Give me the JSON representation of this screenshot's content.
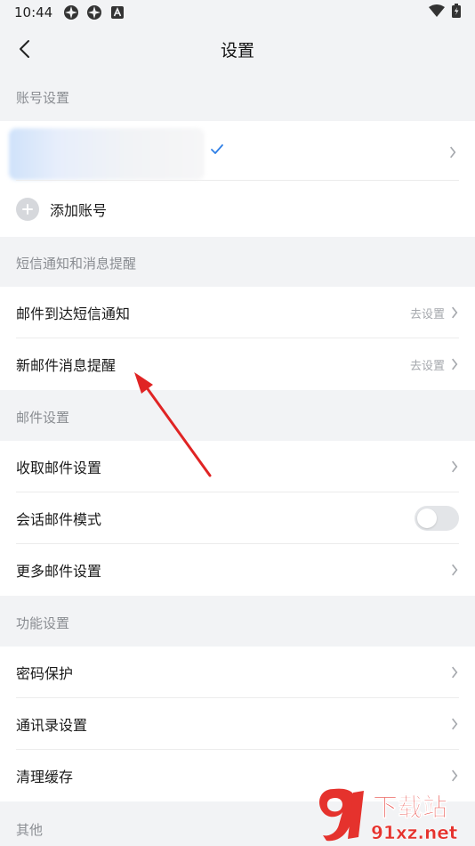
{
  "status_bar": {
    "time": "10:44"
  },
  "nav": {
    "title": "设置"
  },
  "sections": {
    "account": "账号设置",
    "sms": "短信通知和消息提醒",
    "mail": "邮件设置",
    "features": "功能设置",
    "other": "其他"
  },
  "account": {
    "add_label": "添加账号"
  },
  "sms_rows": {
    "arrival": {
      "label": "邮件到达短信通知",
      "action": "去设置"
    },
    "new_mail": {
      "label": "新邮件消息提醒",
      "action": "去设置"
    }
  },
  "mail_rows": {
    "receive": "收取邮件设置",
    "conversation": "会话邮件模式",
    "conversation_on": false,
    "more": "更多邮件设置"
  },
  "feature_rows": {
    "password": "密码保护",
    "contacts": "通讯录设置",
    "cache": "清理缓存"
  },
  "watermark": {
    "brand": "下载站",
    "site": "91xz.net"
  },
  "colors": {
    "accent": "#2f7fe6",
    "annotation": "#e02424",
    "watermark_red": "#e5322d"
  }
}
